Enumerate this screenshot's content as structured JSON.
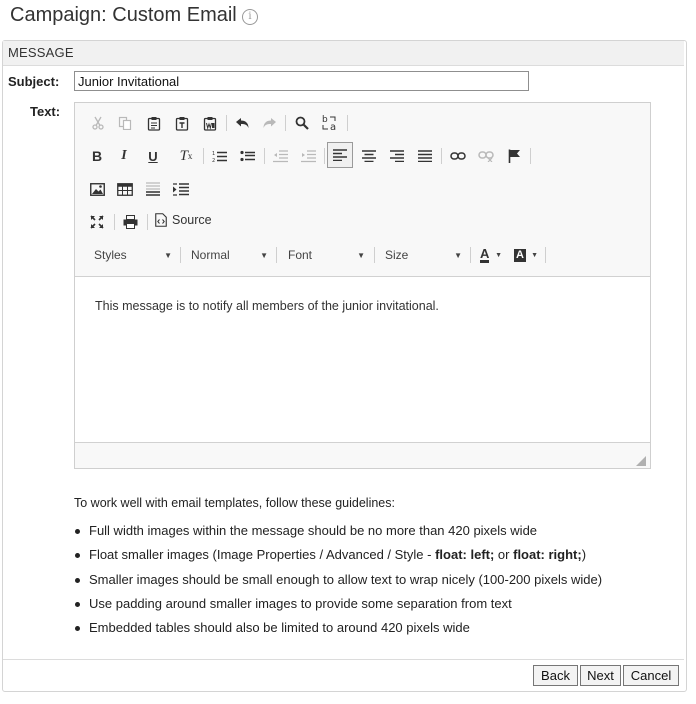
{
  "page": {
    "title": "Campaign: Custom Email",
    "info_icon": "i"
  },
  "panel": {
    "header": "MESSAGE"
  },
  "form": {
    "subject_label": "Subject:",
    "subject_value": "Junior Invitational",
    "text_label": "Text:"
  },
  "toolbar": {
    "row1": [
      "cut-icon",
      "copy-icon",
      "paste-icon",
      "paste-text-icon",
      "paste-from-word-icon",
      "undo-icon",
      "redo-icon",
      "find-icon",
      "replace-icon"
    ],
    "row2": [
      "bold-icon",
      "italic-icon",
      "underline-icon",
      "remove-format-icon",
      "numbered-list-icon",
      "bulleted-list-icon",
      "decrease-indent-icon",
      "increase-indent-icon",
      "align-left-icon",
      "align-center-icon",
      "align-right-icon",
      "justify-icon",
      "link-icon",
      "unlink-icon",
      "anchor-icon"
    ],
    "row3": [
      "image-icon",
      "table-icon",
      "horizontal-rule-icon",
      "page-break-icon"
    ],
    "row4": [
      "maximize-icon",
      "print-icon",
      "source-icon"
    ],
    "source_label": "Source",
    "styles_label": "Styles",
    "format_label": "Normal",
    "font_label": "Font",
    "size_label": "Size",
    "text_color_label": "A",
    "bg_color_label": "A"
  },
  "editor": {
    "content": "This message is to notify all members of the junior invitational."
  },
  "guidelines": {
    "intro": "To work well with email templates, follow these guidelines:",
    "item1": "Full width images within the message should be no more than 420 pixels wide",
    "item2_prefix": "Float smaller images (Image Properties / Advanced / Style - ",
    "item2_bold1": "float: left;",
    "item2_mid": " or ",
    "item2_bold2": "float: right;",
    "item2_suffix": ")",
    "item3": "Smaller images should be small enough to allow text to wrap nicely (100-200 pixels wide)",
    "item4": "Use padding around smaller images to provide some separation from text",
    "item5": "Embedded tables should also be limited to around 420 pixels wide"
  },
  "buttons": {
    "back": "Back",
    "next": "Next",
    "cancel": "Cancel"
  }
}
